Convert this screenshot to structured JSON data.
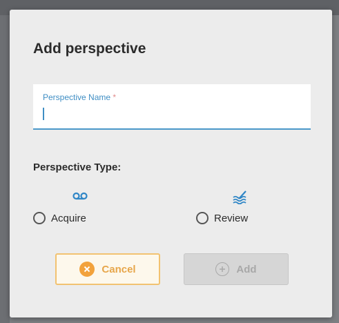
{
  "dialog": {
    "title": "Add perspective",
    "name_field": {
      "label": "Perspective Name",
      "required_marker": "*",
      "value": "",
      "placeholder": ""
    },
    "type_section": {
      "label": "Perspective Type:",
      "options": [
        {
          "label": "Acquire",
          "icon": "voicemail-icon",
          "selected": false
        },
        {
          "label": "Review",
          "icon": "waves-pen-icon",
          "selected": false
        }
      ]
    },
    "buttons": {
      "cancel_label": "Cancel",
      "add_label": "Add",
      "add_disabled": true
    }
  },
  "colors": {
    "accent_blue": "#3f8ec4",
    "cancel_orange": "#f2a23c",
    "disabled_gray": "#a8a8a8",
    "dialog_bg": "#ececec"
  }
}
